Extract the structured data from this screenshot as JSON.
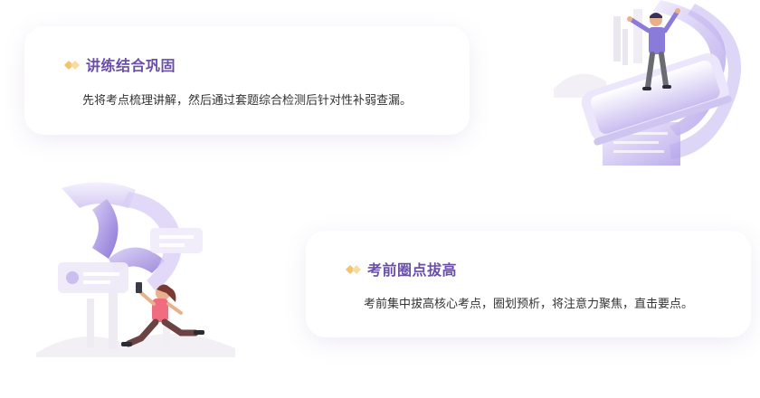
{
  "features": [
    {
      "title": "讲练结合巩固",
      "description": "先将考点梳理讲解，然后通过套题综合检测后针对性补弱查漏。",
      "icon": "double-diamond-bullet-icon",
      "illustration": "man-standing-on-phone-illustration"
    },
    {
      "title": "考前圈点拔高",
      "description": "考前集中拔高核心考点，圈划预析，将注意力聚焦，直击要点。",
      "icon": "double-diamond-bullet-icon",
      "illustration": "woman-running-with-phone-illustration"
    }
  ],
  "colors": {
    "title": "#6a4ea8",
    "text": "#333333",
    "accent_purple": "#9b86e0",
    "accent_gold": "#f3c46a"
  }
}
